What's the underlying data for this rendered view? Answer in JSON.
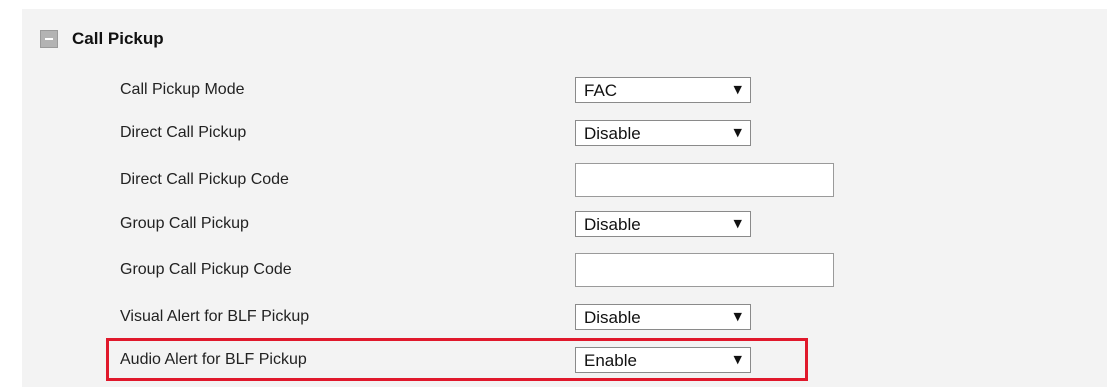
{
  "section": {
    "title": "Call Pickup"
  },
  "rows": [
    {
      "label": "Call Pickup Mode",
      "type": "select",
      "value": "FAC"
    },
    {
      "label": "Direct Call Pickup",
      "type": "select",
      "value": "Disable"
    },
    {
      "label": "Direct Call Pickup Code",
      "type": "text",
      "value": ""
    },
    {
      "label": "Group Call Pickup",
      "type": "select",
      "value": "Disable"
    },
    {
      "label": "Group Call Pickup Code",
      "type": "text",
      "value": ""
    },
    {
      "label": "Visual Alert for BLF Pickup",
      "type": "select",
      "value": "Disable"
    },
    {
      "label": "Audio Alert for BLF Pickup",
      "type": "select",
      "value": "Enable"
    }
  ],
  "icons": {
    "select_arrow": "▼",
    "collapse": "minus-square-icon"
  },
  "colors": {
    "panel_background": "#f3f3f3",
    "highlight_border": "#e0182b"
  }
}
